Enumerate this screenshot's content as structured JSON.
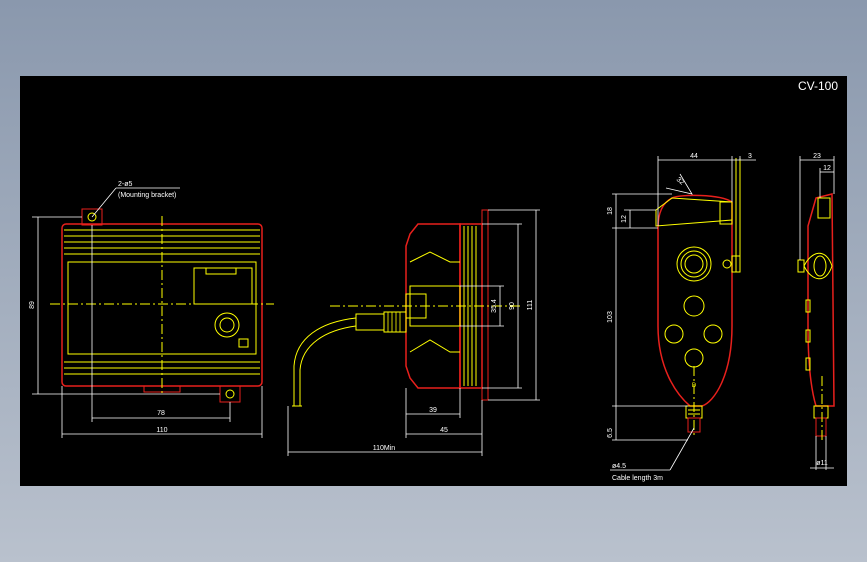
{
  "drawing": {
    "title": "CV-100",
    "colors": {
      "background": "#000000",
      "outline": "#e8201c",
      "detail": "#ffff00",
      "dimension": "#ffffff"
    }
  },
  "front_view": {
    "note_line1": "2-ø5",
    "note_line2": "(Mounting bracket)",
    "dim_height": "89",
    "dim_holes": "78",
    "dim_width": "110"
  },
  "side_view": {
    "dim_inner": "35.4",
    "dim_mid": "90",
    "dim_outer": "111",
    "dim_a": "39",
    "dim_b": "45",
    "dim_cable": "110Min"
  },
  "pendant_view": {
    "dim_width": "44",
    "dim_tab": "3",
    "dim_top": "18",
    "dim_sub": "12",
    "dim_angle": "32",
    "dim_length": "103",
    "dim_bottom": "6.5",
    "led_label": "D",
    "cable_note1": "ø4.5",
    "cable_note2": "Cable length 3m"
  },
  "pendant_side": {
    "dim_depth": "23",
    "dim_sub": "12",
    "dim_base": "ø11"
  }
}
